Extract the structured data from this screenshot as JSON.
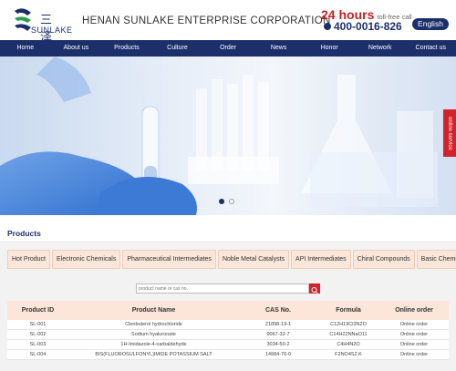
{
  "header": {
    "logo_cn": "三 泽",
    "logo_en": "SUNLAKE",
    "company_name": "HENAN SUNLAKE ENTERPRISE CORPORATION",
    "hours": "24 hours",
    "toll_free": "toll-free call",
    "phone": "400-0016-826",
    "language_button": "English"
  },
  "nav": {
    "items": [
      "Home",
      "About us",
      "Products",
      "Culture",
      "Order",
      "News",
      "Honor",
      "Network",
      "Contact us"
    ]
  },
  "banner": {
    "side_tab": "online service"
  },
  "products": {
    "title": "Products",
    "tabs": [
      "Hot Product",
      "Electronic Chemicals",
      "Pharmaceutical Intermediates",
      "Noble Metal Catalysts",
      "API Intermediates",
      "Chiral Compounds",
      "Basic Chemicals"
    ],
    "search_placeholder": "product name or cas no.",
    "columns": [
      "Product ID",
      "Product Name",
      "CAS No.",
      "Formula",
      "Online order"
    ],
    "rows": [
      [
        "SL-001",
        "Clenbuterol hydrochloride",
        "21898-19-1",
        "C12H19Cl3N2O",
        "Online order"
      ],
      [
        "SL-002",
        "Sodium hyaluronate",
        "9067-32-7",
        "C14H22NNaO11",
        "Online order"
      ],
      [
        "SL-003",
        "1H-Imidazole-4-carbaldehyde",
        "3034-50-2",
        "C4H4N2O",
        "Online order"
      ],
      [
        "SL-004",
        "BIS(FLUOROSULFONYL)IMIDE POTASSIUM SALT",
        "14984-76-0",
        "F2NO4S2.K",
        "Online order"
      ]
    ]
  },
  "colors": {
    "brand_navy": "#1c2f6b",
    "accent_red": "#d3222a",
    "tab_bg": "#fbe6d9"
  }
}
